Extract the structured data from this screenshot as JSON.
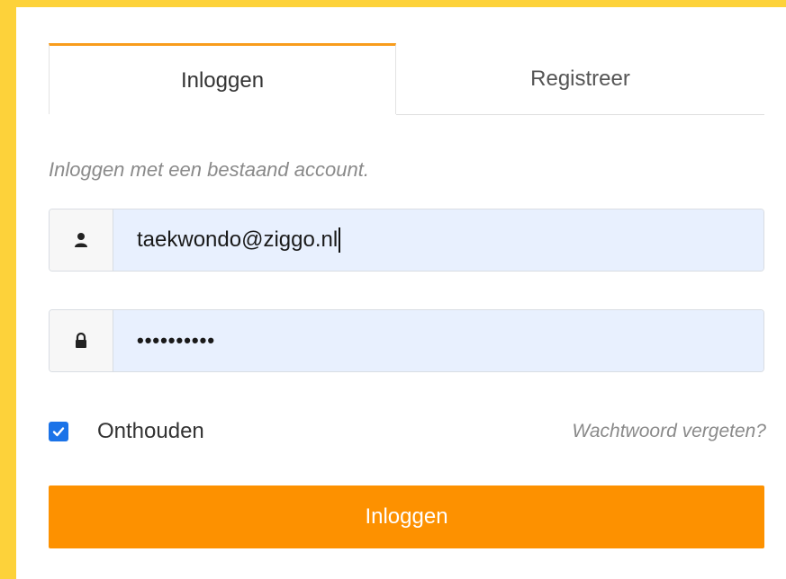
{
  "tabs": {
    "login_label": "Inloggen",
    "register_label": "Registreer"
  },
  "subtitle": "Inloggen met een bestaand account.",
  "username": {
    "value": "taekwondo@ziggo.nl",
    "icon": "user-icon"
  },
  "password": {
    "masked_value": "••••••••••",
    "icon": "lock-icon"
  },
  "remember": {
    "label": "Onthouden",
    "checked": true
  },
  "forgot_label": "Wachtwoord vergeten?",
  "submit_label": "Inloggen",
  "colors": {
    "background": "#fdd23a",
    "accent": "#fd9100",
    "tab_border": "#f89c1c",
    "input_fill": "#e8f0fe",
    "checkbox": "#1b73e8"
  }
}
